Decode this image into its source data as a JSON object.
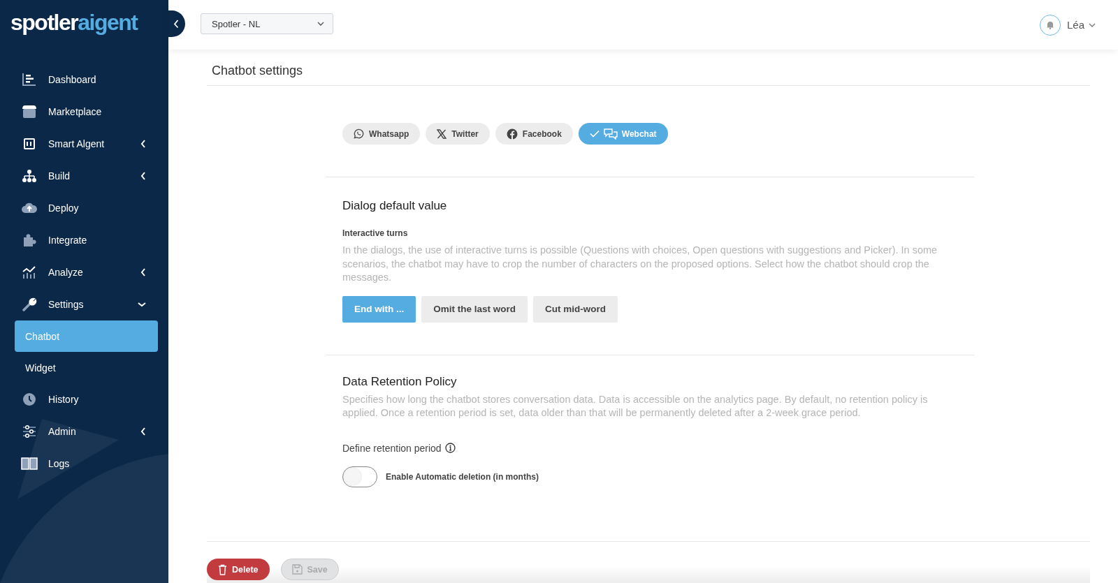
{
  "logo": {
    "text_1": "spotler",
    "text_2": "aigent"
  },
  "sidebar": {
    "items": [
      {
        "label": "Dashboard",
        "selected": false
      },
      {
        "label": "Marketplace",
        "selected": false
      },
      {
        "label": "Smart Algent",
        "selected": false,
        "expanded": false
      },
      {
        "label": "Build",
        "selected": false,
        "expanded": false
      },
      {
        "label": "Deploy",
        "selected": false
      },
      {
        "label": "Integrate",
        "selected": false
      },
      {
        "label": "Analyze",
        "selected": false,
        "expanded": false
      },
      {
        "label": "Settings",
        "selected": false,
        "expanded": true,
        "children": [
          {
            "label": "Chatbot",
            "selected": true
          },
          {
            "label": "Widget",
            "selected": false
          }
        ]
      },
      {
        "label": "History",
        "selected": false
      },
      {
        "label": "Admin",
        "selected": false,
        "expanded": false
      },
      {
        "label": "Logs",
        "selected": false
      }
    ]
  },
  "topbar": {
    "workspace": "Spotler - NL",
    "user": "Léa"
  },
  "page": {
    "title": "Chatbot settings",
    "channels": [
      {
        "label": "Whatsapp",
        "selected": false
      },
      {
        "label": "Twitter",
        "selected": false
      },
      {
        "label": "Facebook",
        "selected": false
      },
      {
        "label": "Webchat",
        "selected": true
      }
    ],
    "dialog": {
      "title": "Dialog default value",
      "subtitle": "Interactive turns",
      "description": "In the dialogs, the use of interactive turns is possible (Questions with choices, Open questions with suggestions and Picker). In some scenarios, the chatbot may have to crop the number of characters on the proposed options. Select how the chatbot should crop the messages.",
      "options": [
        {
          "label": "End with ...",
          "selected": true
        },
        {
          "label": "Omit the last word",
          "selected": false
        },
        {
          "label": "Cut mid-word",
          "selected": false
        }
      ]
    },
    "retention": {
      "title": "Data Retention Policy",
      "description": "Specifies how long the chatbot stores conversation data. Data is accessible on the analytics page. By default, no retention policy is applied. Once a retention period is set, data older than that will be permanently deleted after a 2-week grace period.",
      "label": "Define retention period",
      "toggle": {
        "label": "Enable Automatic deletion (in months)",
        "on": false
      }
    },
    "actions": [
      {
        "label": "Delete",
        "kind": "danger",
        "disabled": false
      },
      {
        "label": "Save",
        "kind": "save",
        "disabled": true
      }
    ]
  }
}
